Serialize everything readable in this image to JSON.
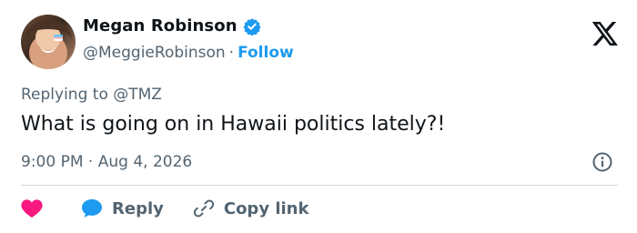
{
  "author": {
    "name": "Megan Robinson",
    "handle": "@MeggieRobinson",
    "separator": "·",
    "follow_label": "Follow"
  },
  "reply_context": {
    "prefix": "Replying to",
    "mention": "@TMZ"
  },
  "tweet": {
    "text": "What is going on in Hawaii politics lately?!",
    "time": "9:00 PM",
    "separator": "·",
    "date": "Aug 4, 2026"
  },
  "actions": {
    "reply_label": "Reply",
    "copy_link_label": "Copy link"
  },
  "colors": {
    "accent": "#1d9bf0",
    "like": "#f91880",
    "text": "#0f1419",
    "muted": "#536471",
    "divider": "#cfd9de"
  },
  "icons": [
    "verified-badge-icon",
    "x-logo-icon",
    "info-icon",
    "heart-icon",
    "reply-bubble-icon",
    "link-icon"
  ]
}
